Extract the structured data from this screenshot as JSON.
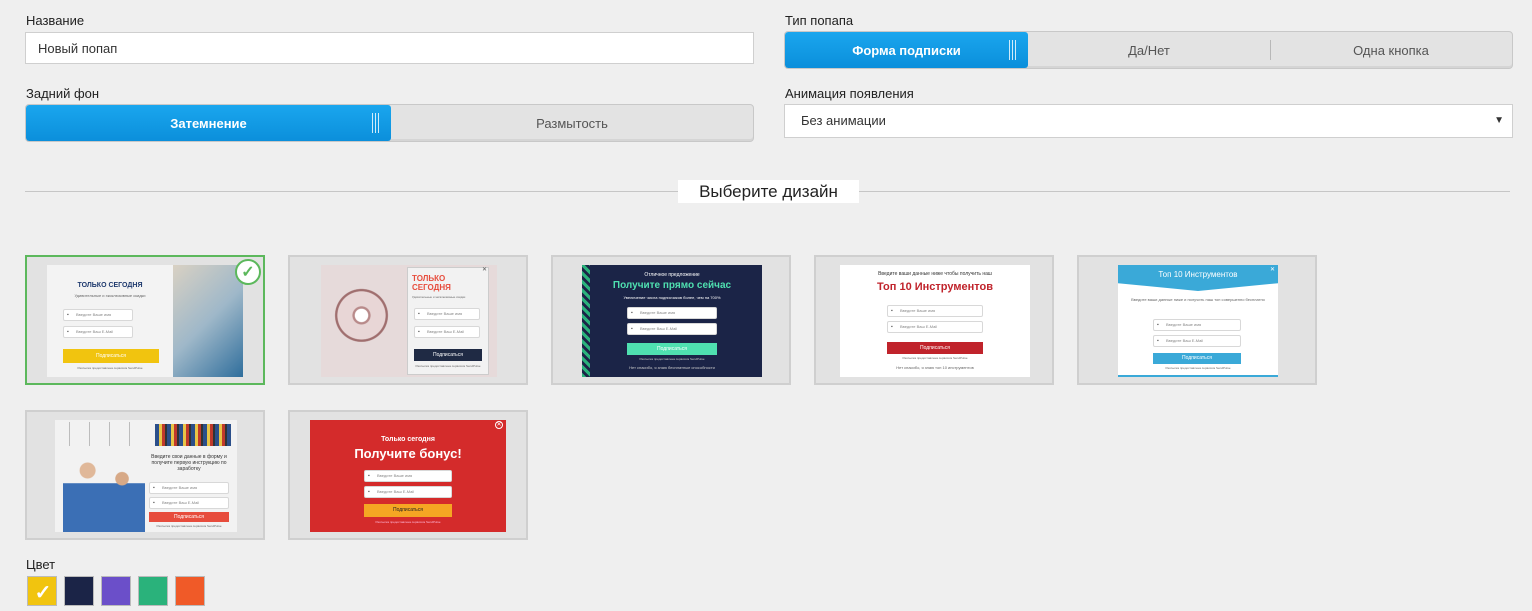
{
  "name_field": {
    "label": "Название",
    "value": "Новый попап"
  },
  "popup_type": {
    "label": "Тип попапа",
    "options": [
      "Форма подписки",
      "Да/Нет",
      "Одна кнопка"
    ],
    "selected": 0
  },
  "background": {
    "label": "Задний фон",
    "options": [
      "Затемнение",
      "Размытость"
    ],
    "selected": 0
  },
  "animation": {
    "label": "Анимация появления",
    "value": "Без анимации",
    "arrow": "▼"
  },
  "design_section": {
    "title": "Выберите дизайн"
  },
  "designs": [
    {
      "title": "ТОЛЬКО СЕГОДНЯ",
      "subtitle": "Удивительные и эксклюзивные скидки",
      "field1": "Введите Ваше имя",
      "field2": "Введите Ваш E-Mail",
      "button": "Подписаться",
      "footnote": "Рассылка предоставлена сервисом SendPulse",
      "selected": true
    },
    {
      "title": "ТОЛЬКО СЕГОДНЯ",
      "subtitle": "Удивительные и эксклюзивные скидки",
      "field1": "Введите Ваше имя",
      "field2": "Введите Ваш E-Mail",
      "button": "Подписаться",
      "footnote": "Рассылка предоставлена сервисом SendPulse"
    },
    {
      "kicker": "Отличное предложение",
      "title": "Получите прямо сейчас",
      "subtitle": "Увеличение числа подписчиков более, чем на 700%",
      "field1": "Введите Ваше имя",
      "field2": "Введите Ваш E-Mail",
      "button": "Подписаться",
      "footnote": "Рассылка предоставлена сервисом SendPulse",
      "thanks": "Нет спасибо, я знаю бесплатные способности"
    },
    {
      "kicker": "Введите ваши данные ниже чтобы получить наш",
      "title": "Топ 10 Инструментов",
      "field1": "Введите Ваше имя",
      "field2": "Введите Ваш E-Mail",
      "button": "Подписаться",
      "footnote": "Рассылка предоставлена сервисом SendPulse",
      "thanks": "Нет спасибо, я знаю топ 10 инструментов"
    },
    {
      "title": "Топ 10 Инструментов",
      "subtitle": "Введите ваши данные ниже и получить наш топ совершенно бесплатно",
      "field1": "Введите Ваше имя",
      "field2": "Введите Ваш E-Mail",
      "button": "Подписаться",
      "footnote": "Рассылка предоставлена сервисом SendPulse"
    },
    {
      "title": "Введите свои данные в форму и получите первую инструкцию по заработку",
      "field1": "Введите Ваше имя",
      "field2": "Введите Ваш E-Mail",
      "button": "Подписаться",
      "footnote": "Рассылка предоставлена сервисом SendPulse"
    },
    {
      "kicker": "Только сегодня",
      "title": "Получите бонус!",
      "field1": "Введите Ваше имя",
      "field2": "Введите Ваш E-Mail",
      "button": "Подписаться",
      "footnote": "Рассылка предоставлена сервисом SendPulse"
    }
  ],
  "color_section": {
    "label": "Цвет",
    "swatches": [
      "#f1c40f",
      "#1b2447",
      "#6b4fc9",
      "#2ab27b",
      "#f05a28"
    ],
    "selected": 0,
    "check": "✓"
  },
  "colors": {
    "accent": "#0b8fdb",
    "selected_border": "#5cb85c"
  }
}
